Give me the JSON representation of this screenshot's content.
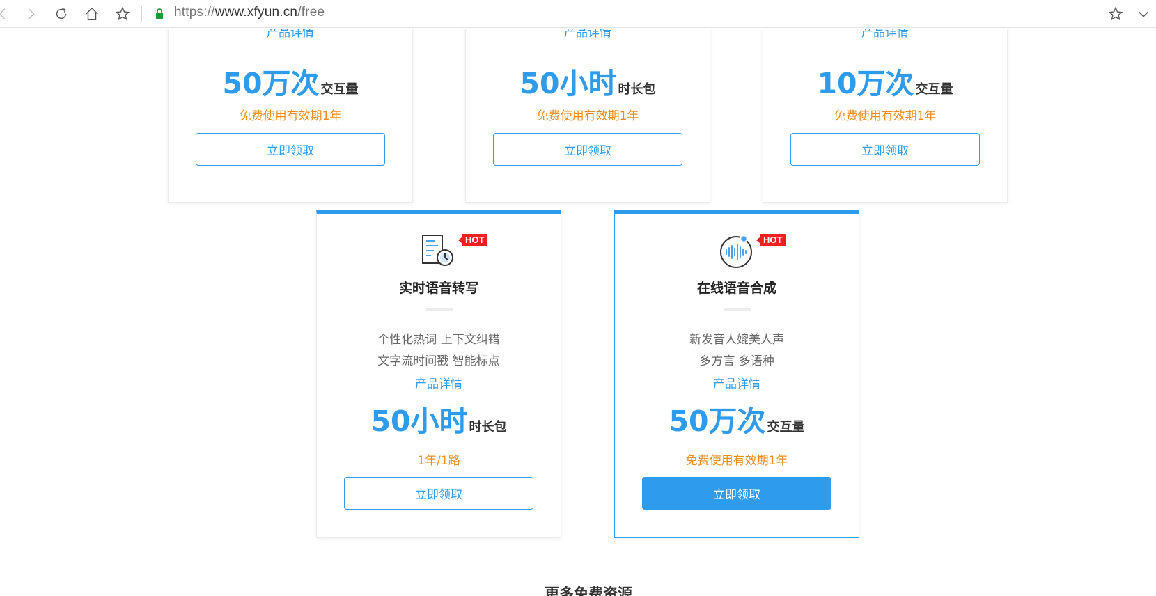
{
  "browser": {
    "url_scheme": "https://",
    "url_host": "www.xfyun.cn",
    "url_path": "/free"
  },
  "top_cards": [
    {
      "detail": "产品详情",
      "amount": "50万次",
      "unit": "交互量",
      "validity": "免费使用有效期1年",
      "button": "立即领取"
    },
    {
      "detail": "产品详情",
      "amount": "50小时",
      "unit": "时长包",
      "validity": "免费使用有效期1年",
      "button": "立即领取"
    },
    {
      "detail": "产品详情",
      "amount": "10万次",
      "unit": "交互量",
      "validity": "免费使用有效期1年",
      "button": "立即领取"
    }
  ],
  "bottom_cards": [
    {
      "badge": "HOT",
      "icon": "document-clock-icon",
      "title": "实时语音转写",
      "features": [
        "个性化热词 上下文纠错",
        "文字流时间戳 智能标点"
      ],
      "detail": "产品详情",
      "amount": "50小时",
      "unit": "时长包",
      "validity": "1年/1路",
      "button": "立即领取"
    },
    {
      "badge": "HOT",
      "icon": "soundwave-icon",
      "title": "在线语音合成",
      "features": [
        "新发音人媲美人声",
        "多方言 多语种"
      ],
      "detail": "产品详情",
      "amount": "50万次",
      "unit": "交互量",
      "validity": "免费使用有效期1年",
      "button": "立即领取"
    }
  ],
  "section_heading": "更多免费资源",
  "colors": {
    "accent": "#2f9bec",
    "orange": "#f08c1a",
    "hot": "#f12020"
  }
}
